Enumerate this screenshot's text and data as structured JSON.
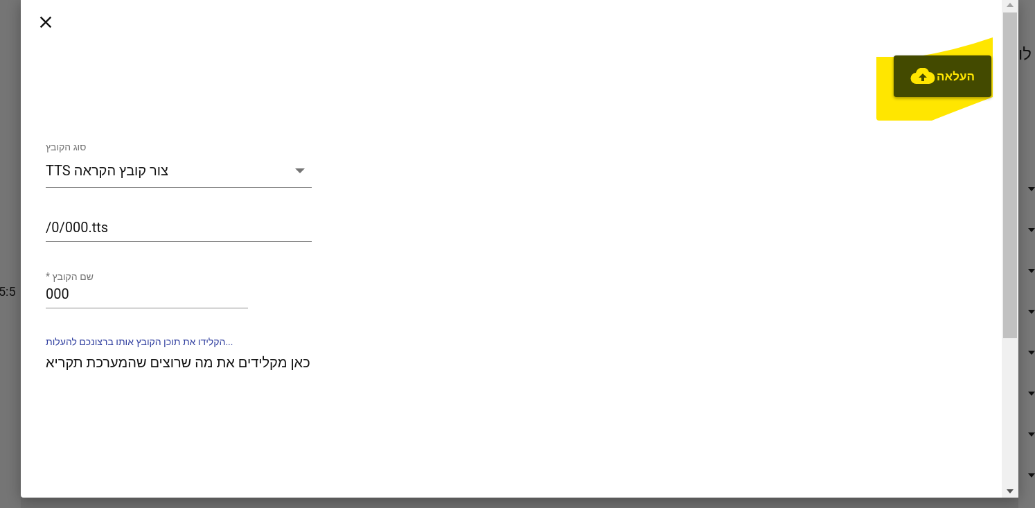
{
  "background": {
    "left_text": "5:5",
    "right_text": "לו"
  },
  "dialog": {
    "upload_button": {
      "label": "העלאה",
      "highlighted": true
    },
    "fields": [
      {
        "kind": "select",
        "label": "סוג הקובץ",
        "value": "TTS צור קובץ הקראה",
        "focused": false
      },
      {
        "kind": "text",
        "value": "/0/000.tts",
        "focused": false
      },
      {
        "kind": "text",
        "label": "* שם הקובץ",
        "value": "000",
        "focused": false,
        "short": true
      },
      {
        "kind": "textarea",
        "label": "הקלידו את תוכן הקובץ אותו ברצונכם להעלות...",
        "value": "כאן מקלידים את מה שרוצים שהמערכת תקריא",
        "focused": true
      }
    ]
  }
}
